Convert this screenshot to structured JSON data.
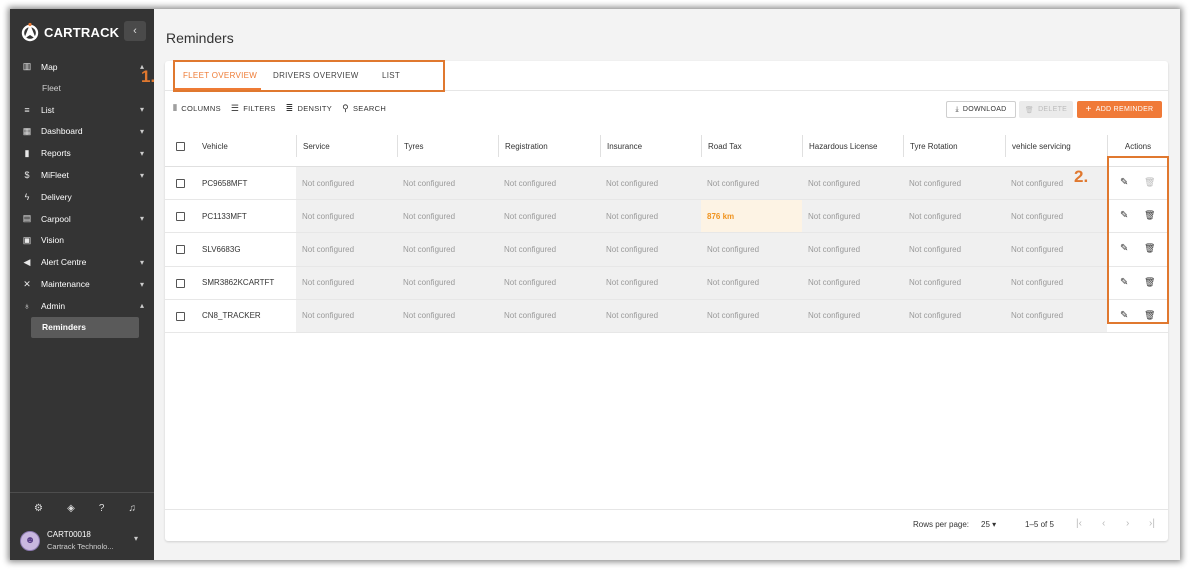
{
  "brand": {
    "name": "CARTRACK"
  },
  "sidebar": {
    "items": [
      {
        "label": "Map",
        "icon": "map-icon",
        "glyph": "▥",
        "chev": "▴",
        "sub": [
          {
            "label": "Fleet"
          }
        ]
      },
      {
        "label": "List",
        "icon": "list-icon",
        "glyph": "≡",
        "chev": "▾"
      },
      {
        "label": "Dashboard",
        "icon": "dashboard-icon",
        "glyph": "▦",
        "chev": "▾"
      },
      {
        "label": "Reports",
        "icon": "reports-icon",
        "glyph": "▮",
        "chev": "▾"
      },
      {
        "label": "MiFleet",
        "icon": "dollar-icon",
        "glyph": "$",
        "chev": "▾"
      },
      {
        "label": "Delivery",
        "icon": "bolt-icon",
        "glyph": "ϟ",
        "chev": ""
      },
      {
        "label": "Carpool",
        "icon": "calendar-icon",
        "glyph": "▤",
        "chev": "▾"
      },
      {
        "label": "Vision",
        "icon": "camera-icon",
        "glyph": "▣",
        "chev": ""
      },
      {
        "label": "Alert Centre",
        "icon": "megaphone-icon",
        "glyph": "◀",
        "chev": "▾"
      },
      {
        "label": "Maintenance",
        "icon": "tools-icon",
        "glyph": "✕",
        "chev": "▾"
      },
      {
        "label": "Admin",
        "icon": "admin-icon",
        "glyph": "♁",
        "chev": "▴",
        "sub": [
          {
            "label": "Reminders",
            "active": true
          }
        ]
      }
    ],
    "bottom_icons": [
      {
        "icon": "settings-icon",
        "glyph": "⚙"
      },
      {
        "icon": "shield-icon",
        "glyph": "◈"
      },
      {
        "icon": "help-icon",
        "glyph": "?"
      },
      {
        "icon": "bell-icon",
        "glyph": "♫"
      }
    ],
    "user": {
      "name": "CART00018",
      "company": "Cartrack Technolo..."
    }
  },
  "page": {
    "title": "Reminders"
  },
  "tabs": [
    {
      "label": "FLEET OVERVIEW",
      "active": true
    },
    {
      "label": "DRIVERS OVERVIEW",
      "active": false
    },
    {
      "label": "LIST",
      "active": false
    }
  ],
  "toolbar": {
    "columns": "COLUMNS",
    "filters": "FILTERS",
    "density": "DENSITY",
    "search": "SEARCH"
  },
  "actions": {
    "download": "DOWNLOAD",
    "delete": "DELETE",
    "add": "ADD REMINDER"
  },
  "table": {
    "columns": [
      "Vehicle",
      "Service",
      "Tyres",
      "Registration",
      "Insurance",
      "Road Tax",
      "Hazardous License",
      "Tyre Rotation",
      "vehicle servicing",
      "Actions"
    ],
    "rows": [
      {
        "vehicle": "PC9658MFT",
        "values": [
          "Not configured",
          "Not configured",
          "Not configured",
          "Not configured",
          "Not configured",
          "Not configured",
          "Not configured",
          "Not configured"
        ],
        "delete_disabled": true
      },
      {
        "vehicle": "PC1133MFT",
        "values": [
          "Not configured",
          "Not configured",
          "Not configured",
          "Not configured",
          "876 km",
          "Not configured",
          "Not configured",
          "Not configured"
        ],
        "delete_disabled": false
      },
      {
        "vehicle": "SLV6683G",
        "values": [
          "Not configured",
          "Not configured",
          "Not configured",
          "Not configured",
          "Not configured",
          "Not configured",
          "Not configured",
          "Not configured"
        ],
        "delete_disabled": false
      },
      {
        "vehicle": "SMR3862KCARTFT",
        "values": [
          "Not configured",
          "Not configured",
          "Not configured",
          "Not configured",
          "Not configured",
          "Not configured",
          "Not configured",
          "Not configured"
        ],
        "delete_disabled": false
      },
      {
        "vehicle": "CN8_TRACKER",
        "values": [
          "Not configured",
          "Not configured",
          "Not configured",
          "Not configured",
          "Not configured",
          "Not configured",
          "Not configured",
          "Not configured"
        ],
        "delete_disabled": false
      }
    ]
  },
  "pagination": {
    "rows_label": "Rows per page:",
    "rows_value": "25",
    "range": "1–5 of 5"
  },
  "annotations": {
    "one": "1.",
    "two": "2."
  },
  "colors": {
    "accent": "#ee7b35",
    "sidebar": "#343434",
    "highlight": "#fdf3e4"
  }
}
